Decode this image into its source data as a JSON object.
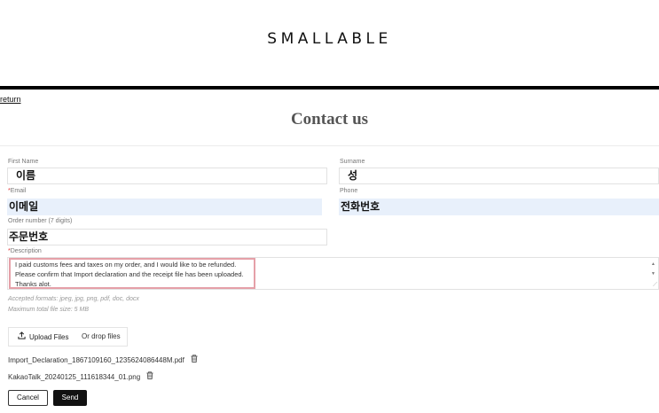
{
  "header": {
    "brand": "SMALLABLE"
  },
  "nav": {
    "return_label": "return"
  },
  "page": {
    "title": "Contact us"
  },
  "form": {
    "first_name": {
      "label": "First Name",
      "value": "이름"
    },
    "surname": {
      "label": "Surname",
      "value": "성"
    },
    "email": {
      "required_mark": "*",
      "label": "Email",
      "value": "이메일"
    },
    "phone": {
      "label": "Phone",
      "value": "전화번호"
    },
    "order_number": {
      "label": "Order number (7 digits)",
      "value": "주문번호"
    },
    "description": {
      "required_mark": "*",
      "label": "Description",
      "value": "I paid customs fees and taxes on my order, and I would like to be refunded.\nPlease confirm that Import declaration and the receipt file has been uploaded.\nThanks alot."
    }
  },
  "attachments": {
    "accepted_formats": "Accepted formats: jpeg, jpg, png, pdf, doc, docx",
    "max_size": "Maximum total file size: 5 MB",
    "upload_label": "Upload Files",
    "drop_label": "Or drop files",
    "files": [
      {
        "name": "Import_Declaration_1867109160_1235624086448M.pdf"
      },
      {
        "name": "KakaoTalk_20240125_111618344_01.png"
      }
    ]
  },
  "actions": {
    "cancel_label": "Cancel",
    "send_label": "Send"
  },
  "icons": {
    "upload": "upload-icon",
    "trash": "trash-icon",
    "scroll": "chevron-icon",
    "resize": "resize-handle-icon"
  },
  "colors": {
    "highlight_border": "#e5a0a8",
    "autofill_bg": "#e8f0fb",
    "primary_button": "#111111"
  }
}
